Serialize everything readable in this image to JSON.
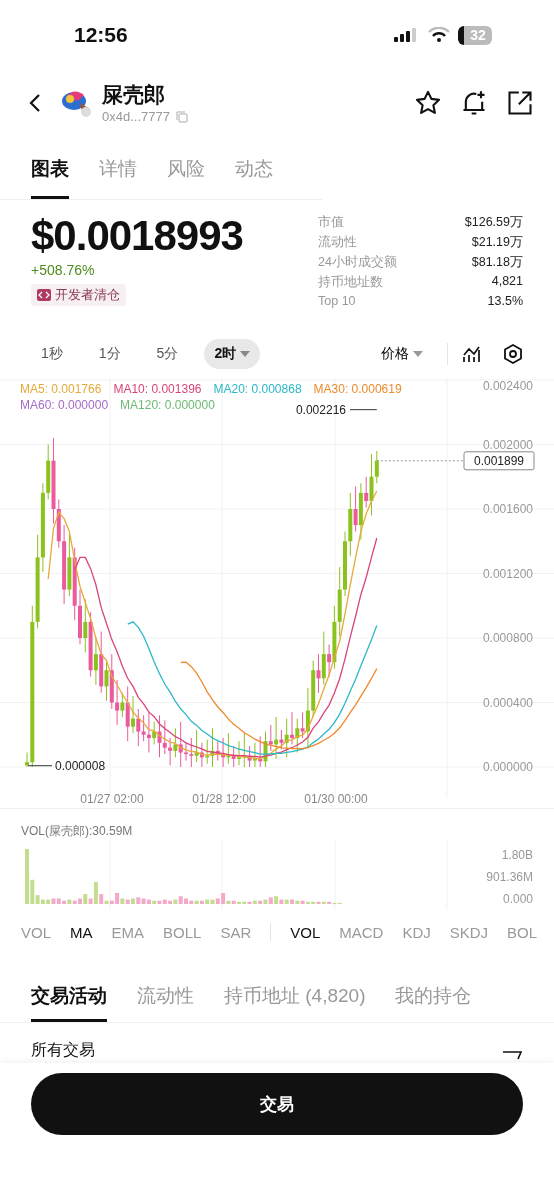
{
  "status_bar": {
    "time": "12:56",
    "battery": "32"
  },
  "header": {
    "title": "屎壳郎",
    "address": "0x4d...7777"
  },
  "tabs": [
    {
      "label": "图表",
      "selected": true
    },
    {
      "label": "详情",
      "selected": false
    },
    {
      "label": "风险",
      "selected": false
    },
    {
      "label": "动态",
      "selected": false
    }
  ],
  "price": {
    "value": "$0.0018993",
    "change": "+508.76%",
    "badge": "开发者清仓"
  },
  "stats": [
    {
      "label": "市值",
      "value": "$126.59万"
    },
    {
      "label": "流动性",
      "value": "$21.19万"
    },
    {
      "label": "24小时成交额",
      "value": "$81.18万"
    },
    {
      "label": "持币地址数",
      "value": "4,821"
    },
    {
      "label": "Top 10",
      "value": "13.5%"
    }
  ],
  "intervals": [
    {
      "label": "1秒",
      "selected": false
    },
    {
      "label": "1分",
      "selected": false
    },
    {
      "label": "5分",
      "selected": false
    },
    {
      "label": "2时",
      "selected": true
    }
  ],
  "price_type": "价格",
  "chart": {
    "ma_legend": [
      {
        "label": "MA5: 0.001766",
        "color": "#e8a83a"
      },
      {
        "label": "MA10: 0.001396",
        "color": "#d9457a"
      },
      {
        "label": "MA20: 0.000868",
        "color": "#2bb8c8"
      },
      {
        "label": "MA30: 0.000619",
        "color": "#ee8a2c"
      },
      {
        "label": "MA60: 0.000000",
        "color": "#a56bc9"
      },
      {
        "label": "MA120: 0.000000",
        "color": "#6cbb73"
      }
    ],
    "y_labels": [
      "0.002400",
      "0.002000",
      "0.001600",
      "0.001200",
      "0.000800",
      "0.000400",
      "0.000000"
    ],
    "x_labels": [
      "01/27 02:00",
      "01/28 12:00",
      "01/30 00:00"
    ],
    "max_label": "0.002216",
    "min_label": "0.000008",
    "current_price": "0.001899"
  },
  "volume": {
    "title": "VOL(屎壳郎):30.59M",
    "y_labels": [
      "1.80B",
      "901.36M",
      "0.000"
    ]
  },
  "indicators_main": [
    {
      "label": "VOL",
      "selected": false
    },
    {
      "label": "MA",
      "selected": true
    },
    {
      "label": "EMA",
      "selected": false
    },
    {
      "label": "BOLL",
      "selected": false
    },
    {
      "label": "SAR",
      "selected": false
    }
  ],
  "indicators_sub": [
    {
      "label": "VOL",
      "selected": true
    },
    {
      "label": "MACD",
      "selected": false
    },
    {
      "label": "KDJ",
      "selected": false
    },
    {
      "label": "SKDJ",
      "selected": false
    },
    {
      "label": "BOL",
      "selected": false
    }
  ],
  "activity_tabs": [
    {
      "label": "交易活动",
      "selected": true
    },
    {
      "label": "流动性",
      "selected": false
    },
    {
      "label": "持币地址 (4,820)",
      "selected": false
    },
    {
      "label": "我的持仓",
      "selected": false
    }
  ],
  "filter": "所有交易",
  "trade_button": "交易"
}
